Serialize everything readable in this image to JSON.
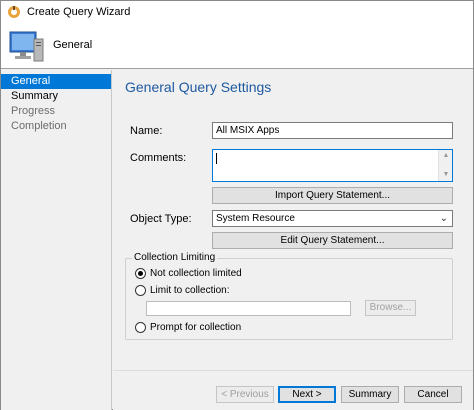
{
  "window": {
    "title": "Create Query Wizard"
  },
  "banner": {
    "title": "General"
  },
  "sidebar": {
    "items": [
      {
        "label": "General"
      },
      {
        "label": "Summary"
      },
      {
        "label": "Progress"
      },
      {
        "label": "Completion"
      }
    ]
  },
  "main": {
    "heading": "General Query Settings",
    "name_label": "Name:",
    "name_value": "All MSIX Apps",
    "comments_label": "Comments:",
    "import_button": "Import Query Statement...",
    "object_type_label": "Object Type:",
    "object_type_value": "System Resource",
    "edit_button": "Edit Query Statement...",
    "collection_group": {
      "legend": "Collection Limiting",
      "opt_not_limited": "Not collection limited",
      "opt_limit_to": "Limit to collection:",
      "browse_button": "Browse...",
      "opt_prompt": "Prompt for collection"
    }
  },
  "footer": {
    "previous": "< Previous",
    "next": "Next >",
    "summary": "Summary",
    "cancel": "Cancel"
  },
  "colors": {
    "accent": "#0078d7",
    "heading": "#1e5aa0"
  }
}
